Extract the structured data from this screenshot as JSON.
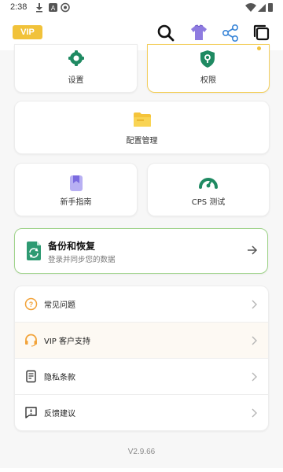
{
  "status_bar": {
    "time": "2:38"
  },
  "app_bar": {
    "vip_label": "VIP"
  },
  "tiles": {
    "settings_label": "设置",
    "permissions_label": "权限",
    "config_label": "配置管理",
    "guide_label": "新手指南",
    "cps_label": "CPS 测试"
  },
  "backup": {
    "title": "备份和恢复",
    "subtitle": "登录并同步您的数据"
  },
  "menu": {
    "items": [
      {
        "label": "常见问题",
        "icon": "help-circle-icon"
      },
      {
        "label": "VIP 客户支持",
        "icon": "headset-icon"
      },
      {
        "label": "隐私条款",
        "icon": "document-icon"
      },
      {
        "label": "反馈建议",
        "icon": "feedback-icon"
      }
    ]
  },
  "version": "V2.9.66",
  "colors": {
    "vip_gold": "#f1c23a",
    "green_accent": "#1f8a62",
    "backup_border": "#9fd38a",
    "permissions_border": "#f3cf5d",
    "orange_icon": "#f2a33a"
  }
}
